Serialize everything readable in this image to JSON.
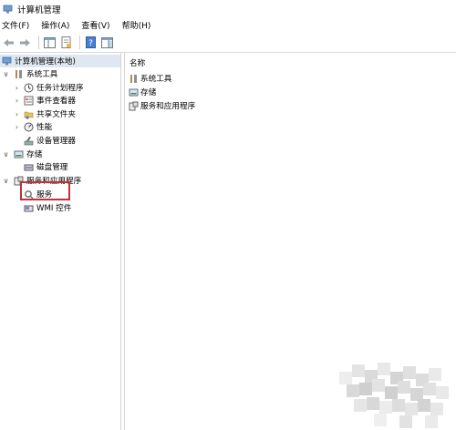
{
  "window": {
    "title": "计算机管理"
  },
  "menu": [
    "文件(F)",
    "操作(A)",
    "查看(V)",
    "帮助(H)"
  ],
  "toolbar": {
    "buttons": [
      "back-arrow-icon",
      "forward-arrow-icon",
      "show-hide-tree-icon",
      "properties-icon",
      "help-icon",
      "console-tree-icon"
    ]
  },
  "tree": {
    "root": "计算机管理(本地)",
    "system_tools": "系统工具",
    "task_scheduler": "任务计划程序",
    "event_viewer": "事件查看器",
    "shared_folders": "共享文件夹",
    "performance": "性能",
    "device_manager": "设备管理器",
    "storage": "存储",
    "disk_management": "磁盘管理",
    "services_apps": "服务和应用程序",
    "services": "服务",
    "wmi": "WMI 控件"
  },
  "list": {
    "header": "名称",
    "items": [
      "系统工具",
      "存储",
      "服务和应用程序"
    ]
  },
  "colors": {
    "highlight_border": "#c0313b",
    "root_selected_bg": "#dfe7f1"
  }
}
